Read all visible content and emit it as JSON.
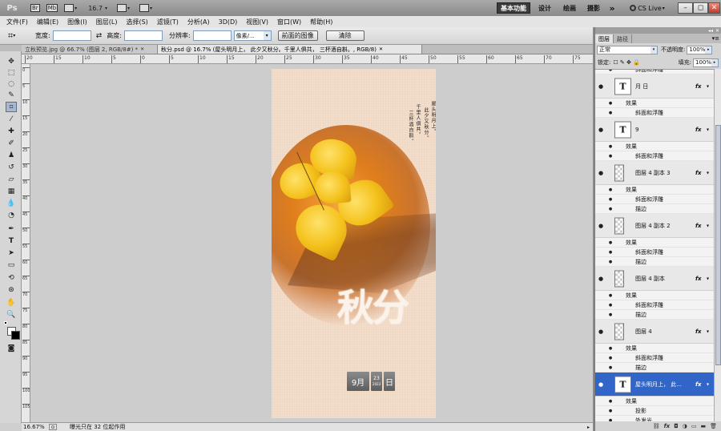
{
  "titlebar": {
    "logo": "Ps",
    "br_label": "Br",
    "mb_label": "Mb",
    "zoom": "16.7",
    "workspaces": [
      "基本功能",
      "设计",
      "绘画",
      "摄影"
    ],
    "more": "»",
    "cslive": "CS Live",
    "win_buttons": [
      "–",
      "◻",
      "✕"
    ]
  },
  "menu": [
    "文件(F)",
    "编辑(E)",
    "图像(I)",
    "图层(L)",
    "选择(S)",
    "滤镜(T)",
    "分析(A)",
    "3D(D)",
    "视图(V)",
    "窗口(W)",
    "帮助(H)"
  ],
  "options": {
    "width_label": "宽度:",
    "swap_symbol": "⇄",
    "height_label": "高度:",
    "resolution_label": "分辨率:",
    "unit_value": "像素/...",
    "front_image_button": "前面的图像",
    "clear_button": "清除"
  },
  "tabs": [
    {
      "label": "立秋预览.jpg @ 66.7% (图层 2, RGB/8#) *",
      "active": false
    },
    {
      "label": "秋分.psd @ 16.7% (屋头明月上，    此夕又秋分。千里人俱共，    三杯酒自斟。, RGB/8)",
      "active": true
    }
  ],
  "tab_close": "✕",
  "ruler": {
    "top_labels": [
      "20",
      "15",
      "10",
      "5",
      "0",
      "5",
      "10",
      "15",
      "20",
      "25",
      "30",
      "35",
      "40",
      "45",
      "50",
      "55",
      "60",
      "65",
      "70",
      "75"
    ],
    "left_labels": [
      "0",
      "5",
      "10",
      "15",
      "20",
      "25",
      "30",
      "35",
      "40",
      "45",
      "50",
      "55",
      "60",
      "65",
      "70",
      "75",
      "80",
      "85",
      "90",
      "95",
      "100",
      "105"
    ]
  },
  "canvas": {
    "poem_lines": [
      "屋头明月上，",
      "此夕又秋分。",
      "千里人俱共，",
      "三杯酒自斟。"
    ],
    "title": "秋分",
    "date_month": "9月",
    "date_day": "23",
    "date_day_sub": "2023",
    "date_weekday": "日",
    "colors": {
      "accent": "#e07e1c",
      "leaf": "#f4c21c",
      "paper": "#f2ddca"
    }
  },
  "status": {
    "zoom": "16.67%",
    "info": "曝光只在 32 位起作用"
  },
  "panel": {
    "tabs": [
      "图层",
      "路径"
    ],
    "blend_mode": "正常",
    "opacity_label": "不透明度:",
    "opacity_value": "100%",
    "lock_label": "锁定:",
    "lock_icons": "☐ ✎ ✥ 🔒",
    "fill_label": "填充:",
    "fill_value": "100%",
    "collapse_symbol": "◂◂",
    "menu_symbol": "▾≡",
    "layers": [
      {
        "type": "effect",
        "name": "斜面和浮雕"
      },
      {
        "type": "layer",
        "thumb": "T",
        "name": "月    日",
        "fx": "fx"
      },
      {
        "type": "effects",
        "name": "效果"
      },
      {
        "type": "effect",
        "name": "斜面和浮雕"
      },
      {
        "type": "layer",
        "thumb": "T",
        "name": "9",
        "fx": "fx"
      },
      {
        "type": "effects",
        "name": "效果"
      },
      {
        "type": "effect",
        "name": "斜面和浮雕"
      },
      {
        "type": "layer",
        "thumb": "checker",
        "name": "图层 4 副本 3",
        "fx": "fx"
      },
      {
        "type": "effects",
        "name": "效果"
      },
      {
        "type": "effect",
        "name": "斜面和浮雕"
      },
      {
        "type": "effect",
        "name": "描边"
      },
      {
        "type": "layer",
        "thumb": "checker",
        "name": "图层 4 副本 2",
        "fx": "fx"
      },
      {
        "type": "effects",
        "name": "效果"
      },
      {
        "type": "effect",
        "name": "斜面和浮雕"
      },
      {
        "type": "effect",
        "name": "描边"
      },
      {
        "type": "layer",
        "thumb": "checker",
        "name": "图层 4 副本",
        "fx": "fx"
      },
      {
        "type": "effects",
        "name": "效果"
      },
      {
        "type": "effect",
        "name": "斜面和浮雕"
      },
      {
        "type": "effect",
        "name": "描边"
      },
      {
        "type": "layer",
        "thumb": "checker",
        "name": "图层 4",
        "fx": "fx"
      },
      {
        "type": "effects",
        "name": "效果"
      },
      {
        "type": "effect",
        "name": "斜面和浮雕"
      },
      {
        "type": "effect",
        "name": "描边"
      },
      {
        "type": "layer",
        "thumb": "T",
        "name": "屋头明月上，    此...",
        "fx": "fx",
        "selected": true
      },
      {
        "type": "effects",
        "name": "效果"
      },
      {
        "type": "effect",
        "name": "投影"
      },
      {
        "type": "effect",
        "name": "外发光"
      }
    ],
    "footer_icons": [
      "⛓",
      "fx",
      "◘",
      "◑",
      "▭",
      "▬",
      "🗑"
    ]
  }
}
